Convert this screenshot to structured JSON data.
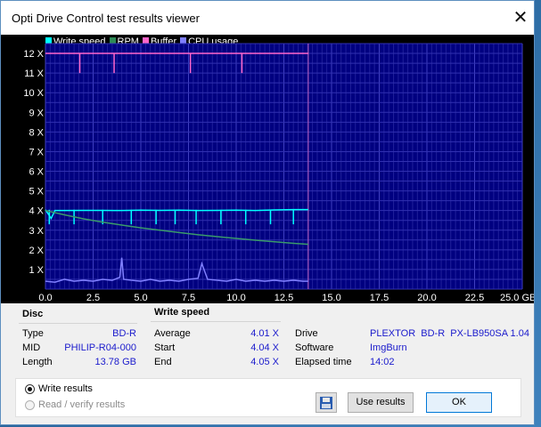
{
  "window": {
    "title": "Opti Drive Control test results viewer",
    "close_glyph": "✕"
  },
  "legend": [
    {
      "label": "Write speed",
      "color": "#00ffff"
    },
    {
      "label": "RPM",
      "color": "#2e8b57"
    },
    {
      "label": "Buffer",
      "color": "#ff66cc"
    },
    {
      "label": "CPU usage",
      "color": "#8080ff"
    }
  ],
  "chart_data": {
    "type": "line",
    "title": "",
    "xlabel": "",
    "ylabel": "",
    "x_ticks": [
      "0.0",
      "2.5",
      "5.0",
      "7.5",
      "10.0",
      "12.5",
      "15.0",
      "17.5",
      "20.0",
      "22.5",
      "25.0 GB"
    ],
    "y_ticks": [
      "1 X",
      "2 X",
      "3 X",
      "4 X",
      "5 X",
      "6 X",
      "7 X",
      "8 X",
      "9 X",
      "10 X",
      "11 X",
      "12 X"
    ],
    "xlim": [
      0,
      25
    ],
    "ylim": [
      0,
      12.5
    ],
    "grid": true,
    "background": "#000080",
    "data_end_x": 13.78,
    "series": [
      {
        "name": "Write speed",
        "color": "#00ffff",
        "x": [
          0,
          0.3,
          0.5,
          1,
          2,
          3,
          4,
          5,
          6,
          7,
          8,
          9,
          10,
          11,
          12,
          13,
          13.78
        ],
        "y": [
          4.04,
          3.6,
          4.0,
          4.0,
          4.01,
          4.01,
          4.0,
          4.02,
          4.01,
          4.02,
          4.0,
          4.01,
          4.02,
          4.0,
          4.03,
          4.05,
          4.05
        ],
        "dips_x": [
          0.2,
          1.5,
          3.0,
          4.5,
          5.8,
          6.8,
          7.9,
          9.2,
          10.5,
          11.8,
          13.0
        ],
        "dip_y": 3.3
      },
      {
        "name": "RPM",
        "color": "#3a9a6a",
        "x": [
          0,
          1,
          2,
          3,
          4,
          5,
          6,
          7,
          8,
          9,
          10,
          11,
          12,
          13,
          13.78
        ],
        "y": [
          4.0,
          3.78,
          3.58,
          3.41,
          3.26,
          3.12,
          3.0,
          2.88,
          2.77,
          2.67,
          2.58,
          2.49,
          2.41,
          2.33,
          2.28
        ]
      },
      {
        "name": "Buffer",
        "color": "#ff66cc",
        "x": [
          0,
          13.78
        ],
        "y": [
          12.0,
          12.0
        ],
        "dips_x": [
          1.8,
          3.6,
          7.6,
          10.3
        ],
        "dip_y": 11.0
      },
      {
        "name": "CPU usage",
        "color": "#8080ff",
        "x": [
          0,
          0.5,
          1,
          1.5,
          2,
          2.5,
          3,
          3.5,
          3.9,
          4.0,
          4.1,
          4.5,
          5,
          5.5,
          6,
          6.5,
          7,
          7.5,
          8,
          8.2,
          8.5,
          9,
          9.5,
          10,
          10.5,
          11,
          11.5,
          12,
          12.5,
          13,
          13.5,
          13.78
        ],
        "y": [
          0.4,
          0.35,
          0.5,
          0.4,
          0.45,
          0.4,
          0.5,
          0.45,
          0.6,
          1.6,
          0.5,
          0.45,
          0.4,
          0.5,
          0.4,
          0.45,
          0.4,
          0.5,
          0.55,
          1.3,
          0.5,
          0.45,
          0.4,
          0.5,
          0.4,
          0.45,
          0.4,
          0.45,
          0.4,
          0.45,
          0.4,
          0.4
        ]
      }
    ]
  },
  "disc": {
    "header": "Disc",
    "rows": [
      {
        "label": "Type",
        "value": "BD-R"
      },
      {
        "label": "MID",
        "value": "PHILIP-R04-000"
      },
      {
        "label": "Length",
        "value": "13.78 GB"
      }
    ]
  },
  "write_speed": {
    "header": "Write speed",
    "rows": [
      {
        "label": "Average",
        "value": "4.01 X"
      },
      {
        "label": "Start",
        "value": "4.04 X"
      },
      {
        "label": "End",
        "value": "4.05 X"
      }
    ]
  },
  "drive_info": {
    "rows": [
      {
        "label": "Drive",
        "value": "PLEXTOR  BD-R  PX-LB950SA 1.04"
      },
      {
        "label": "Software",
        "value": "ImgBurn"
      },
      {
        "label": "Elapsed time",
        "value": "14:02"
      }
    ]
  },
  "options": {
    "write_results": "Write results",
    "read_verify_results": "Read / verify results",
    "selected": "write_results"
  },
  "buttons": {
    "use_results": "Use results",
    "ok": "OK",
    "save_icon": "floppy-disk-icon"
  }
}
